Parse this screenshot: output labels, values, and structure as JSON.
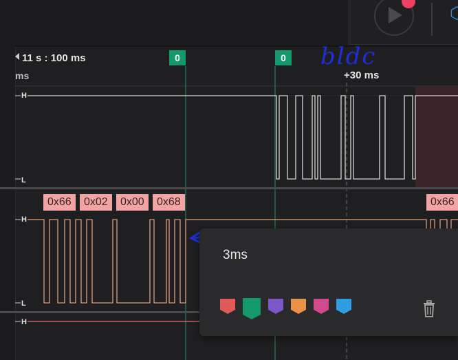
{
  "header": {
    "time_main": "11 s : 100 ms",
    "unit_left": "ms",
    "offset_label": "+30 ms",
    "marker_a": "0",
    "marker_b": "0",
    "handwriting": "bldc"
  },
  "channel_top": {
    "high": "H",
    "low": "L"
  },
  "channel_mid": {
    "high": "H",
    "low": "L",
    "bytes": [
      "0x66",
      "0x02",
      "0x00",
      "0x68"
    ],
    "byte_right": "0x66"
  },
  "channel_bottom": {
    "high": "H"
  },
  "popup": {
    "text": "3ms",
    "colors": [
      "#e05a5a",
      "#149a6a",
      "#7a58c8",
      "#e8924a",
      "#d04a8e",
      "#2f9ee0"
    ],
    "delete_icon": "trash-icon"
  },
  "toolbar": {
    "play_icon": "play-icon",
    "record_icon": "record-dot-icon",
    "hex_icon": "hexagon-icon"
  },
  "colors": {
    "marker": "#149a6a",
    "signal_top": "#d8d8d8",
    "signal_mid": "#d9a07c",
    "signal_bottom": "#e8707a",
    "byte_chip": "#f2a4a4"
  }
}
